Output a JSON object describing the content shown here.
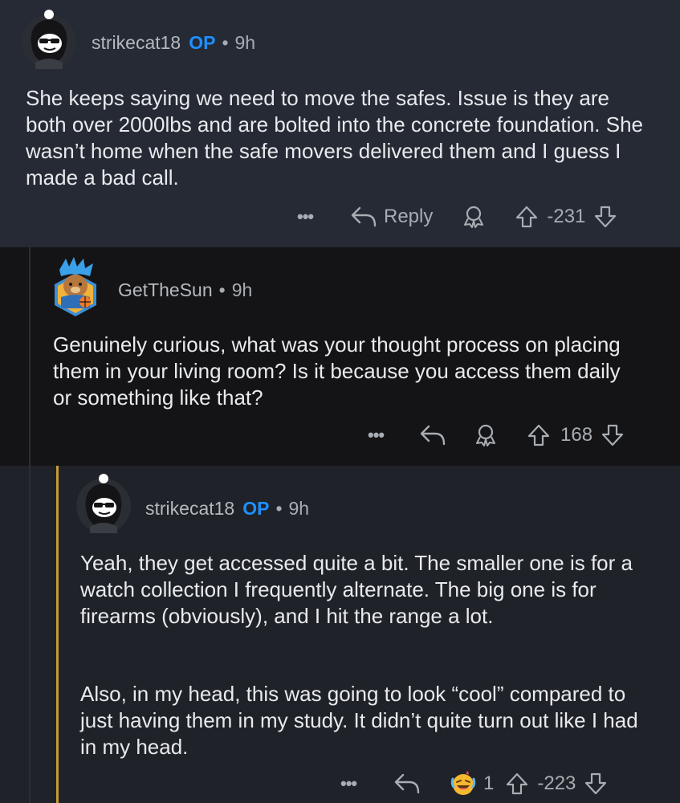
{
  "comments": [
    {
      "username": "strikecat18",
      "op_badge": "OP",
      "separator": "•",
      "age": "9h",
      "avatar_icon": "snoo-sunglasses-avatar-icon",
      "body": "She keeps saying we need to move the safes. Issue is they are both over 2000lbs and are bolted into the concrete foundation. She wasn’t home when the safe movers delivered them and I guess I made a bad call.",
      "more": "•••",
      "reply_label": "Reply",
      "award_icon": "award-icon",
      "score": "-231"
    },
    {
      "username": "GetTheSun",
      "separator": "•",
      "age": "9h",
      "avatar_icon": "blue-hair-bear-avatar-icon",
      "body": "Genuinely curious, what was your thought process on placing them in your living room? Is it because you access them daily or something like that?",
      "more": "•••",
      "award_icon": "award-icon",
      "score": "168"
    },
    {
      "username": "strikecat18",
      "op_badge": "OP",
      "separator": "•",
      "age": "9h",
      "avatar_icon": "snoo-sunglasses-avatar-icon",
      "body_p1": "Yeah, they get accessed quite a bit. The smaller one is for a watch collection I frequently alternate. The big one is for firearms (obviously), and I hit the range a lot.",
      "body_p2": "Also, in my head, this was going to look “cool” compared to just having them in my study. It didn’t quite turn out like I had in my head.",
      "more": "•••",
      "award_icon": "laughing-award-icon",
      "award_count": "1",
      "score": "-223"
    }
  ],
  "colors": {
    "op": "#1f8fff",
    "thread_line": "#c69a35",
    "bg_top": "#252a34",
    "bg_mid": "#141416",
    "bg_bottom": "#1f2228"
  }
}
